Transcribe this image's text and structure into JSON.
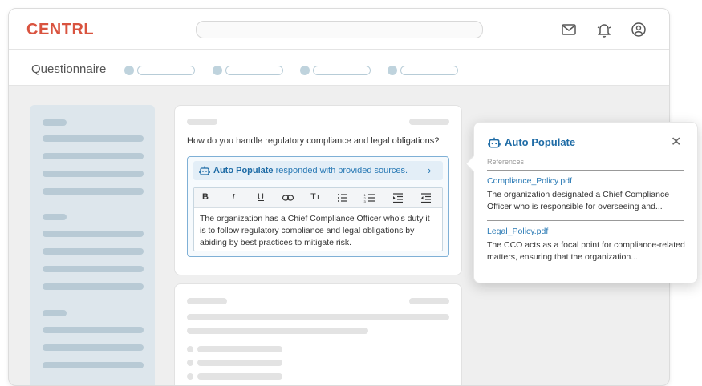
{
  "app": {
    "logo": "CENTRL"
  },
  "header": {
    "icons": [
      "mail-icon",
      "bell-icon",
      "user-icon"
    ]
  },
  "subbar": {
    "title": "Questionnaire"
  },
  "question": {
    "text": "How do you handle regulatory compliance and legal obligations?",
    "banner_bold": "Auto Populate",
    "banner_rest": " responded with provided sources.",
    "answer": "The organization has a Chief Compliance Officer who's duty it is to follow regulatory compliance and legal obligations by abiding by best practices to mitigate risk.",
    "toolbar": [
      "B",
      "I",
      "U",
      "link",
      "Tt",
      "bullet-list",
      "numbered-list",
      "indent",
      "outdent"
    ]
  },
  "popover": {
    "title": "Auto Populate",
    "references_label": "References",
    "refs": [
      {
        "file": "Compliance_Policy.pdf",
        "excerpt": "The organization designated a Chief Compliance Officer who is responsible for overseeing and..."
      },
      {
        "file": "Legal_Policy.pdf",
        "excerpt": "The CCO acts as a focal point for compliance-related matters, ensuring that the organization..."
      }
    ]
  },
  "colors": {
    "brand": "#d9533f",
    "accent": "#2a7ab5",
    "panel": "#dde6ec"
  }
}
